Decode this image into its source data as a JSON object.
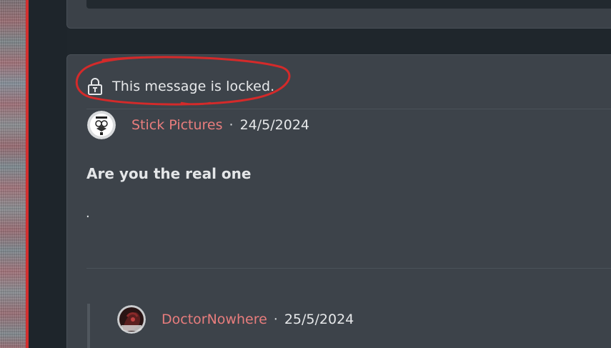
{
  "locked_notice": {
    "text": "This message is locked.",
    "icon": "lock-icon",
    "annotation_color": "#d42a2a"
  },
  "post": {
    "author": "Stick Pictures",
    "separator": "·",
    "date": "24/5/2024",
    "avatar_icon": "avatar-stick-pictures",
    "body": "Are you the real one",
    "extra_line": "."
  },
  "reply": {
    "author": "DoctorNowhere",
    "separator": "·",
    "date": "25/5/2024",
    "avatar_icon": "avatar-doctornowhere"
  },
  "colors": {
    "background": "#1f262c",
    "card": "#3d434a",
    "author_name": "#e87d7d",
    "text": "#e6e8ea",
    "accent_rule": "#d22f2f"
  }
}
